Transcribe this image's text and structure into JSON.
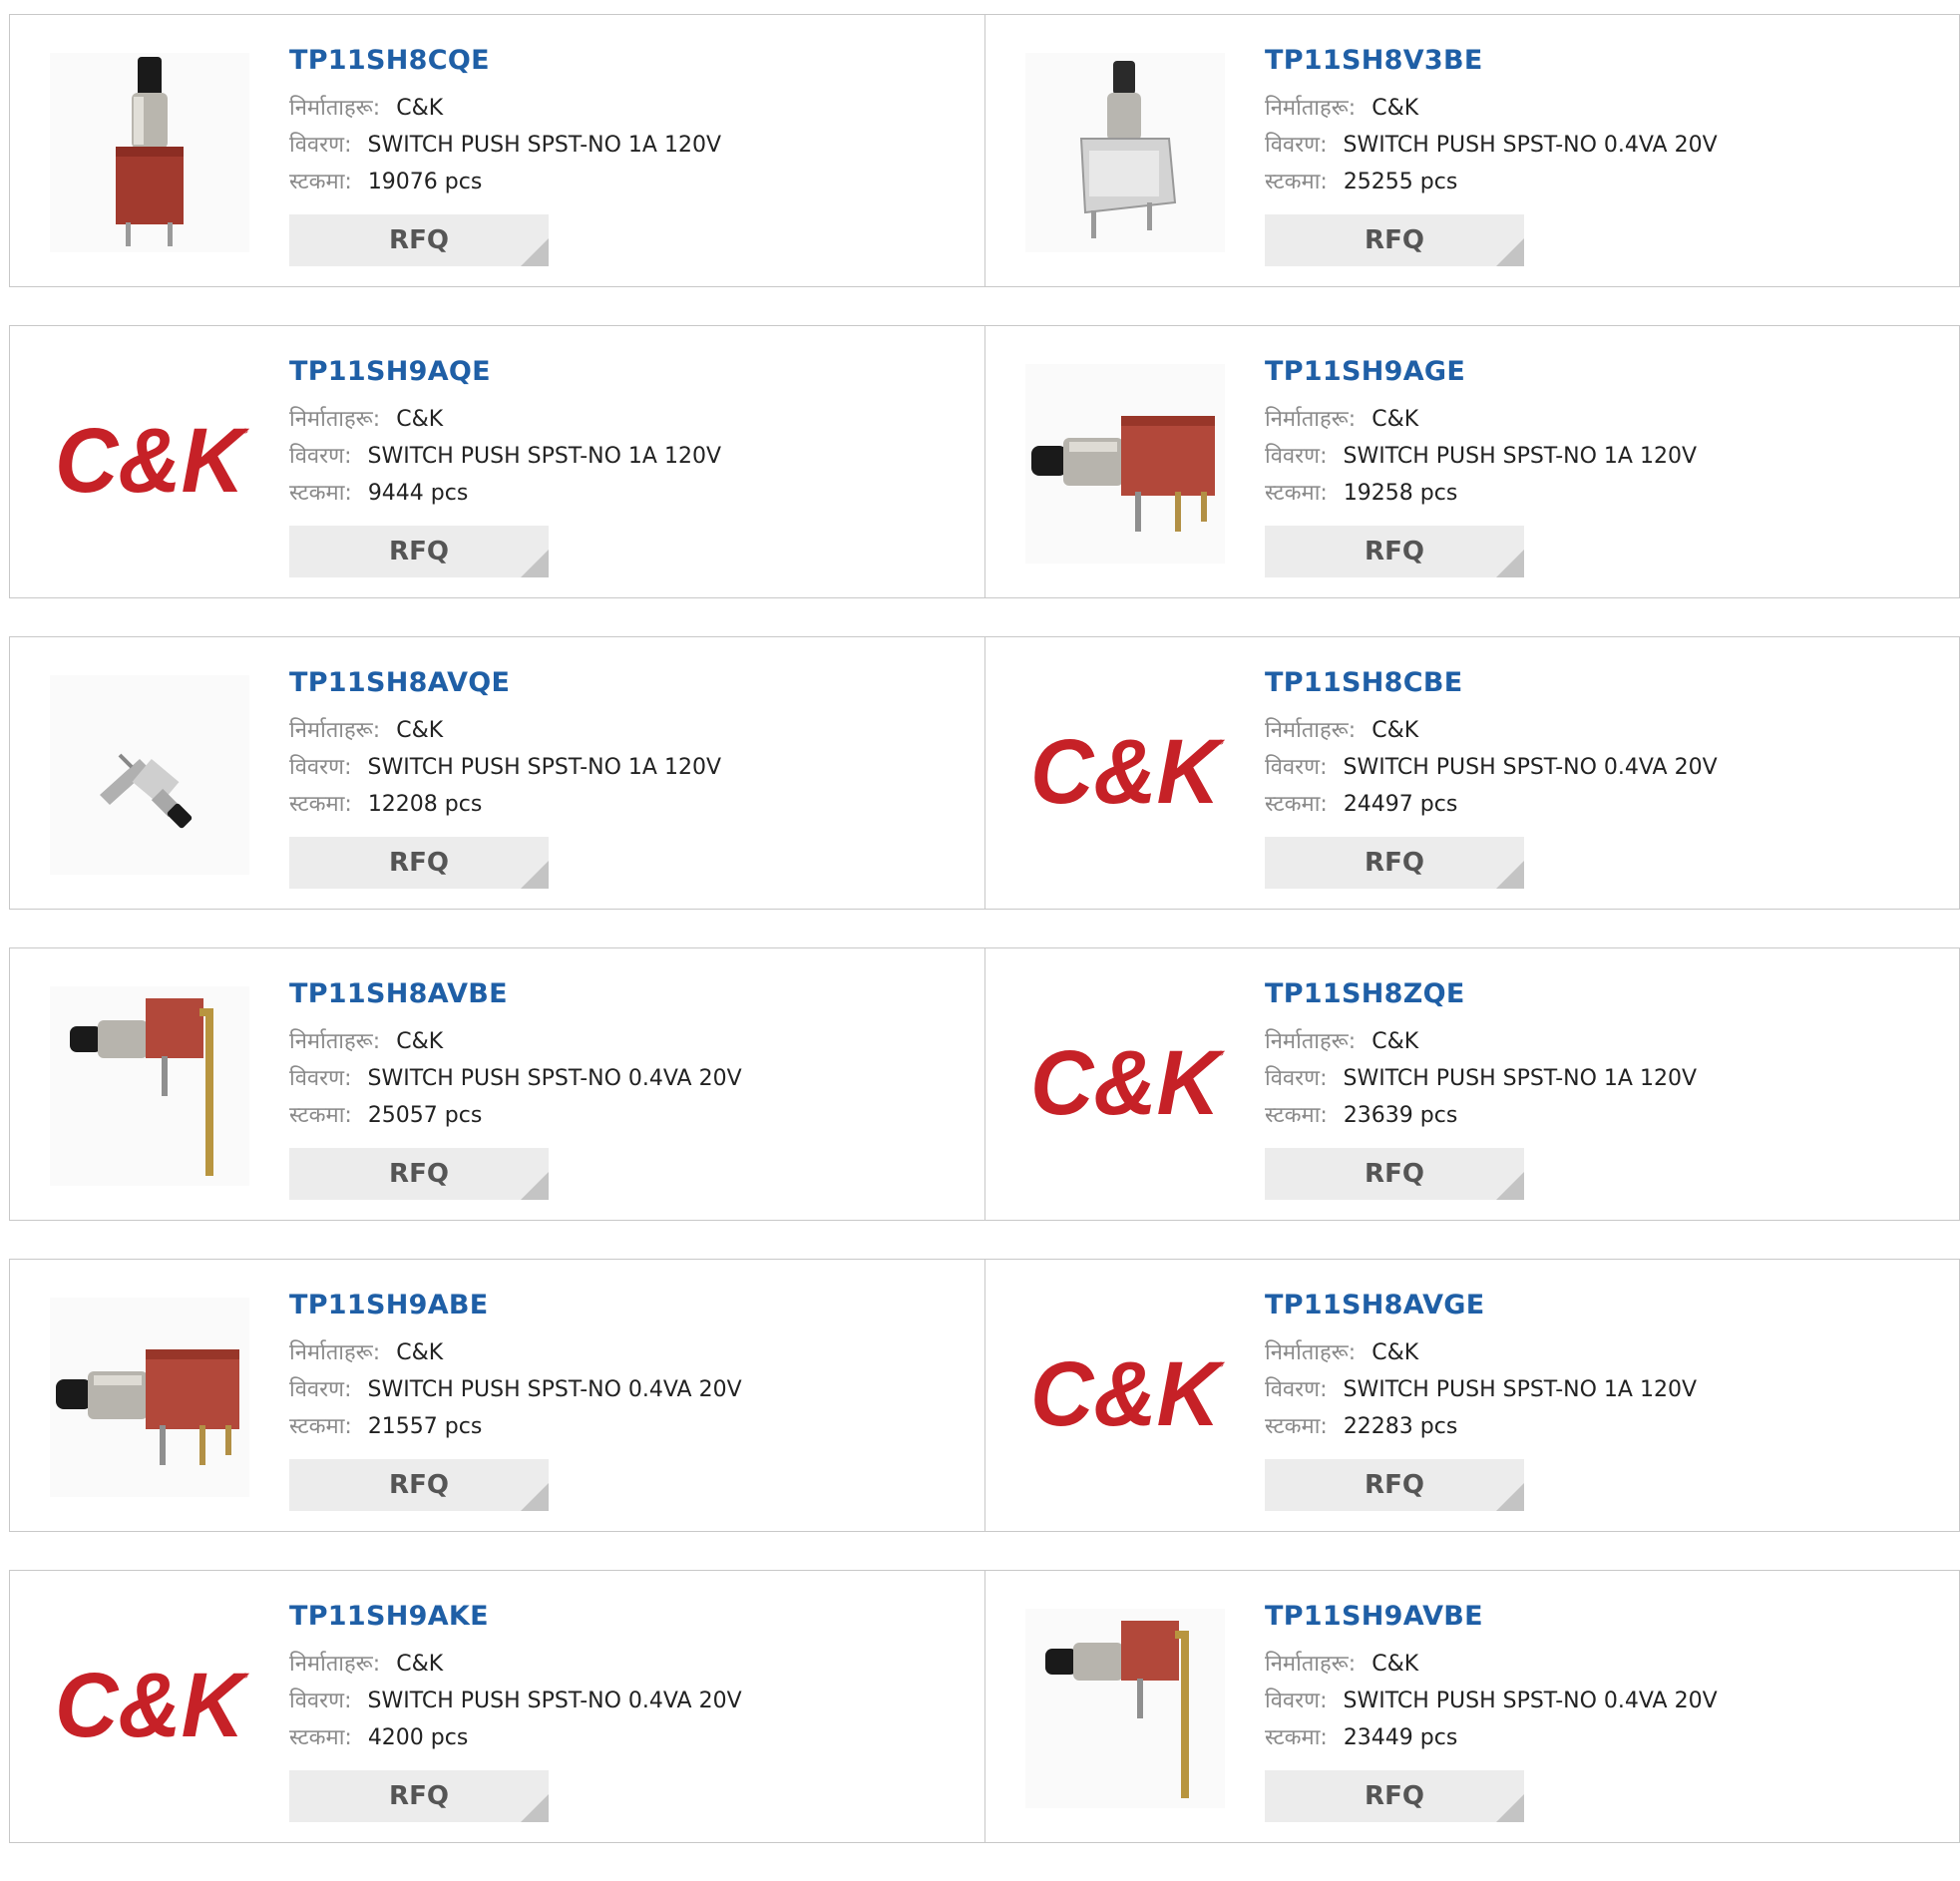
{
  "labels": {
    "manufacturer": "निर्माताहरू:",
    "description": "विवरण:",
    "stock": "स्टकमा:",
    "rfq": "RFQ",
    "logo_text": "C&K"
  },
  "colors": {
    "part_number": "#1f5fa6",
    "logo_red": "#c62127",
    "rfq_bg": "#ececec"
  },
  "products": [
    {
      "part": "TP11SH8CQE",
      "manufacturer": "C&K",
      "description": "SWITCH PUSH SPST-NO 1A 120V",
      "stock": "19076 pcs",
      "image": "vertical-red-switch"
    },
    {
      "part": "TP11SH8V3BE",
      "manufacturer": "C&K",
      "description": "SWITCH PUSH SPST-NO 0.4VA 20V",
      "stock": "25255 pcs",
      "image": "vertical-silver-switch"
    },
    {
      "part": "TP11SH9AQE",
      "manufacturer": "C&K",
      "description": "SWITCH PUSH SPST-NO 1A 120V",
      "stock": "9444 pcs",
      "image": "ck-logo"
    },
    {
      "part": "TP11SH9AGE",
      "manufacturer": "C&K",
      "description": "SWITCH PUSH SPST-NO 1A 120V",
      "stock": "19258 pcs",
      "image": "horizontal-red-switch"
    },
    {
      "part": "TP11SH8AVQE",
      "manufacturer": "C&K",
      "description": "SWITCH PUSH SPST-NO 1A 120V",
      "stock": "12208 pcs",
      "image": "angled-small-switch"
    },
    {
      "part": "TP11SH8CBE",
      "manufacturer": "C&K",
      "description": "SWITCH PUSH SPST-NO 0.4VA 20V",
      "stock": "24497 pcs",
      "image": "ck-logo"
    },
    {
      "part": "TP11SH8AVBE",
      "manufacturer": "C&K",
      "description": "SWITCH PUSH SPST-NO 0.4VA 20V",
      "stock": "25057 pcs",
      "image": "long-lead-switch"
    },
    {
      "part": "TP11SH8ZQE",
      "manufacturer": "C&K",
      "description": "SWITCH PUSH SPST-NO 1A 120V",
      "stock": "23639 pcs",
      "image": "ck-logo"
    },
    {
      "part": "TP11SH9ABE",
      "manufacturer": "C&K",
      "description": "SWITCH PUSH SPST-NO 0.4VA 20V",
      "stock": "21557 pcs",
      "image": "horizontal-red-switch"
    },
    {
      "part": "TP11SH8AVGE",
      "manufacturer": "C&K",
      "description": "SWITCH PUSH SPST-NO 1A 120V",
      "stock": "22283 pcs",
      "image": "ck-logo"
    },
    {
      "part": "TP11SH9AKE",
      "manufacturer": "C&K",
      "description": "SWITCH PUSH SPST-NO 0.4VA 20V",
      "stock": "4200 pcs",
      "image": "ck-logo"
    },
    {
      "part": "TP11SH9AVBE",
      "manufacturer": "C&K",
      "description": "SWITCH PUSH SPST-NO 0.4VA 20V",
      "stock": "23449 pcs",
      "image": "long-lead-switch"
    }
  ]
}
